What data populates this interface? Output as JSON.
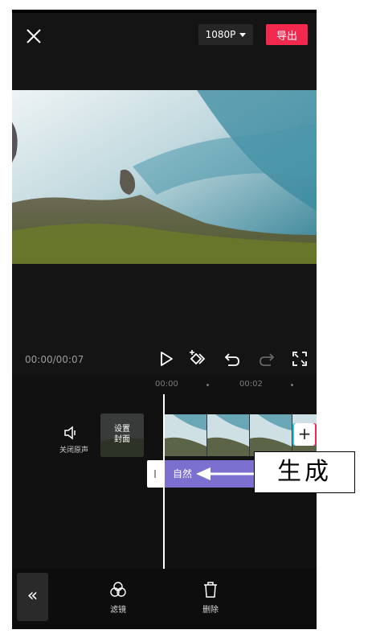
{
  "header": {
    "resolution": "1080P",
    "export_label": "导出"
  },
  "player": {
    "time": "00:00/00:07"
  },
  "timeline": {
    "ruler": [
      "00:00",
      "00:02"
    ],
    "mute_label": "关闭原声",
    "cover_label_line1": "设置",
    "cover_label_line2": "封面",
    "add_label": "+",
    "filter_name": "自然"
  },
  "toolbar": {
    "collapse_label": "«",
    "items": [
      {
        "label": "滤镜",
        "icon": "filter-icon"
      },
      {
        "label": "删除",
        "icon": "trash-icon"
      }
    ]
  },
  "annotation": {
    "text": "生成"
  },
  "colors": {
    "accent": "#f2294f",
    "filter_track": "#7b6fd0",
    "background": "#141414"
  }
}
